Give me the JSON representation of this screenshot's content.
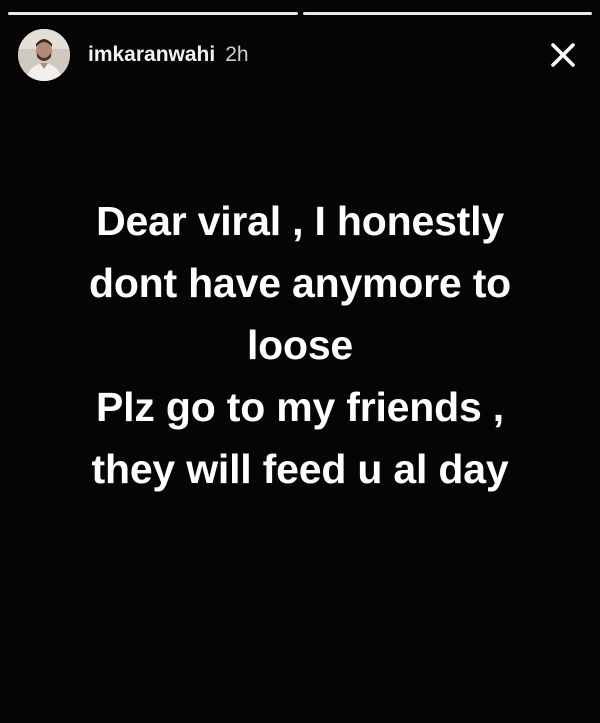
{
  "progress": [
    {
      "fill": 1.0
    },
    {
      "fill": 1.0
    }
  ],
  "header": {
    "username": "imkaranwahi",
    "time": "2h",
    "avatar_icon": "profile-photo",
    "close_icon": "close-x-icon"
  },
  "story": {
    "text": "Dear viral , I honestly\ndont have anymore  to\nloose\nPlz go to my friends ,\nthey will feed u al day"
  },
  "colors": {
    "background": "#050505",
    "text": "#ffffff"
  }
}
